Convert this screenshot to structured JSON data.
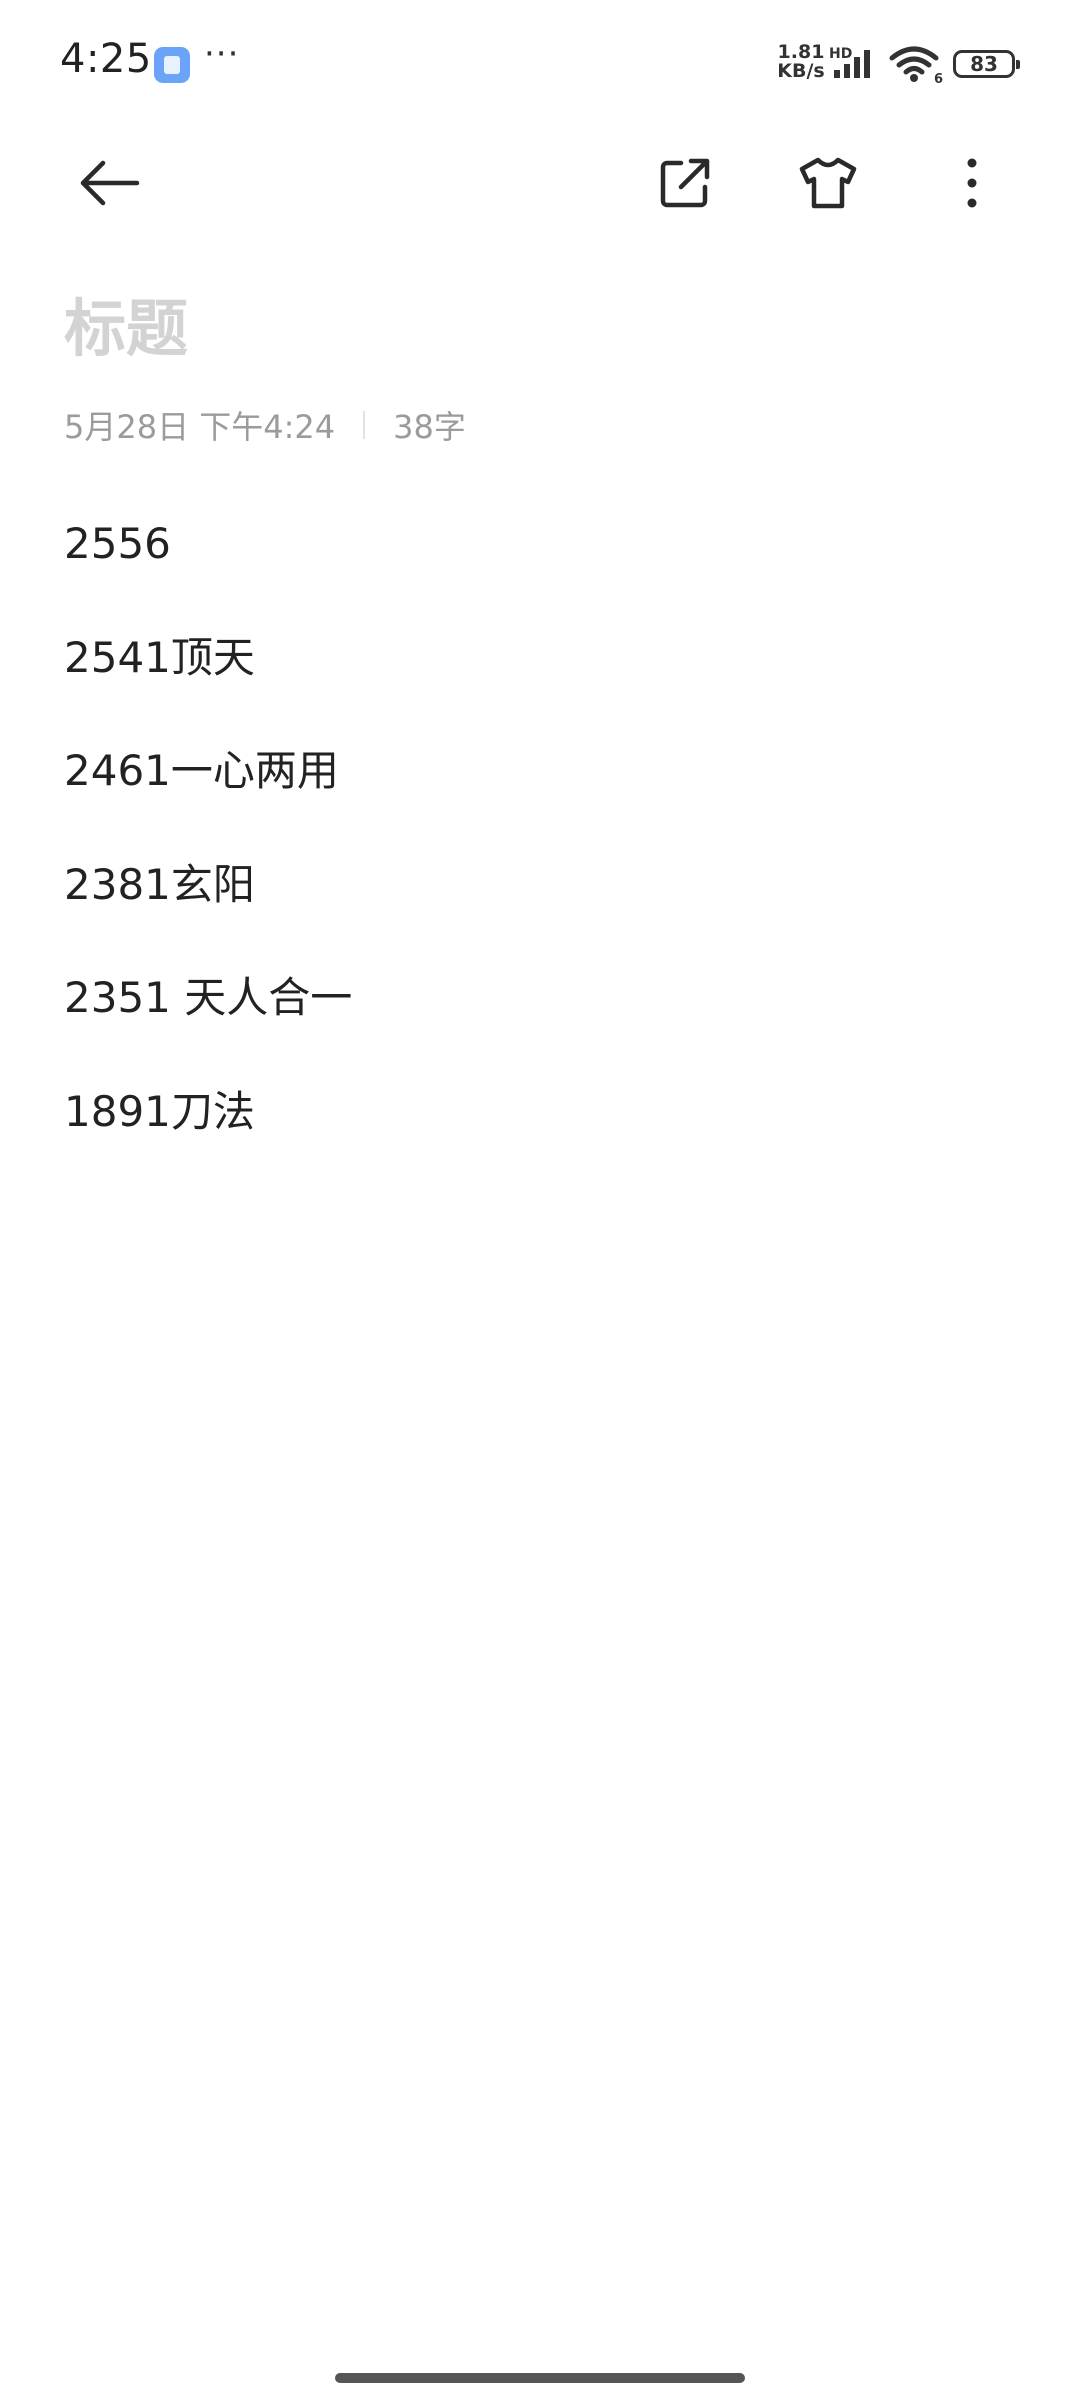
{
  "status_bar": {
    "time": "4:25",
    "more": "···",
    "net_speed_value": "1.81",
    "net_speed_unit": "KB/s",
    "hd_label": "HD",
    "wifi_label": "6",
    "battery": "83"
  },
  "toolbar": {
    "back_icon": "back-arrow-icon",
    "share_icon": "share-external-icon",
    "theme_icon": "tshirt-icon",
    "more_icon": "more-vertical-icon"
  },
  "note": {
    "title_placeholder": "标题",
    "date": "5月28日 下午4:24",
    "word_count": "38字",
    "lines": [
      "2556",
      "2541顶天",
      "2461一心两用",
      "2381玄阳",
      "2351 天人合一",
      "1891刀法"
    ]
  },
  "colors": {
    "background": "#ffffff",
    "text": "#222222",
    "meta": "#9b9b9b",
    "placeholder": "#d3d3d3",
    "accent_app_icon": "#6aa3f8"
  }
}
